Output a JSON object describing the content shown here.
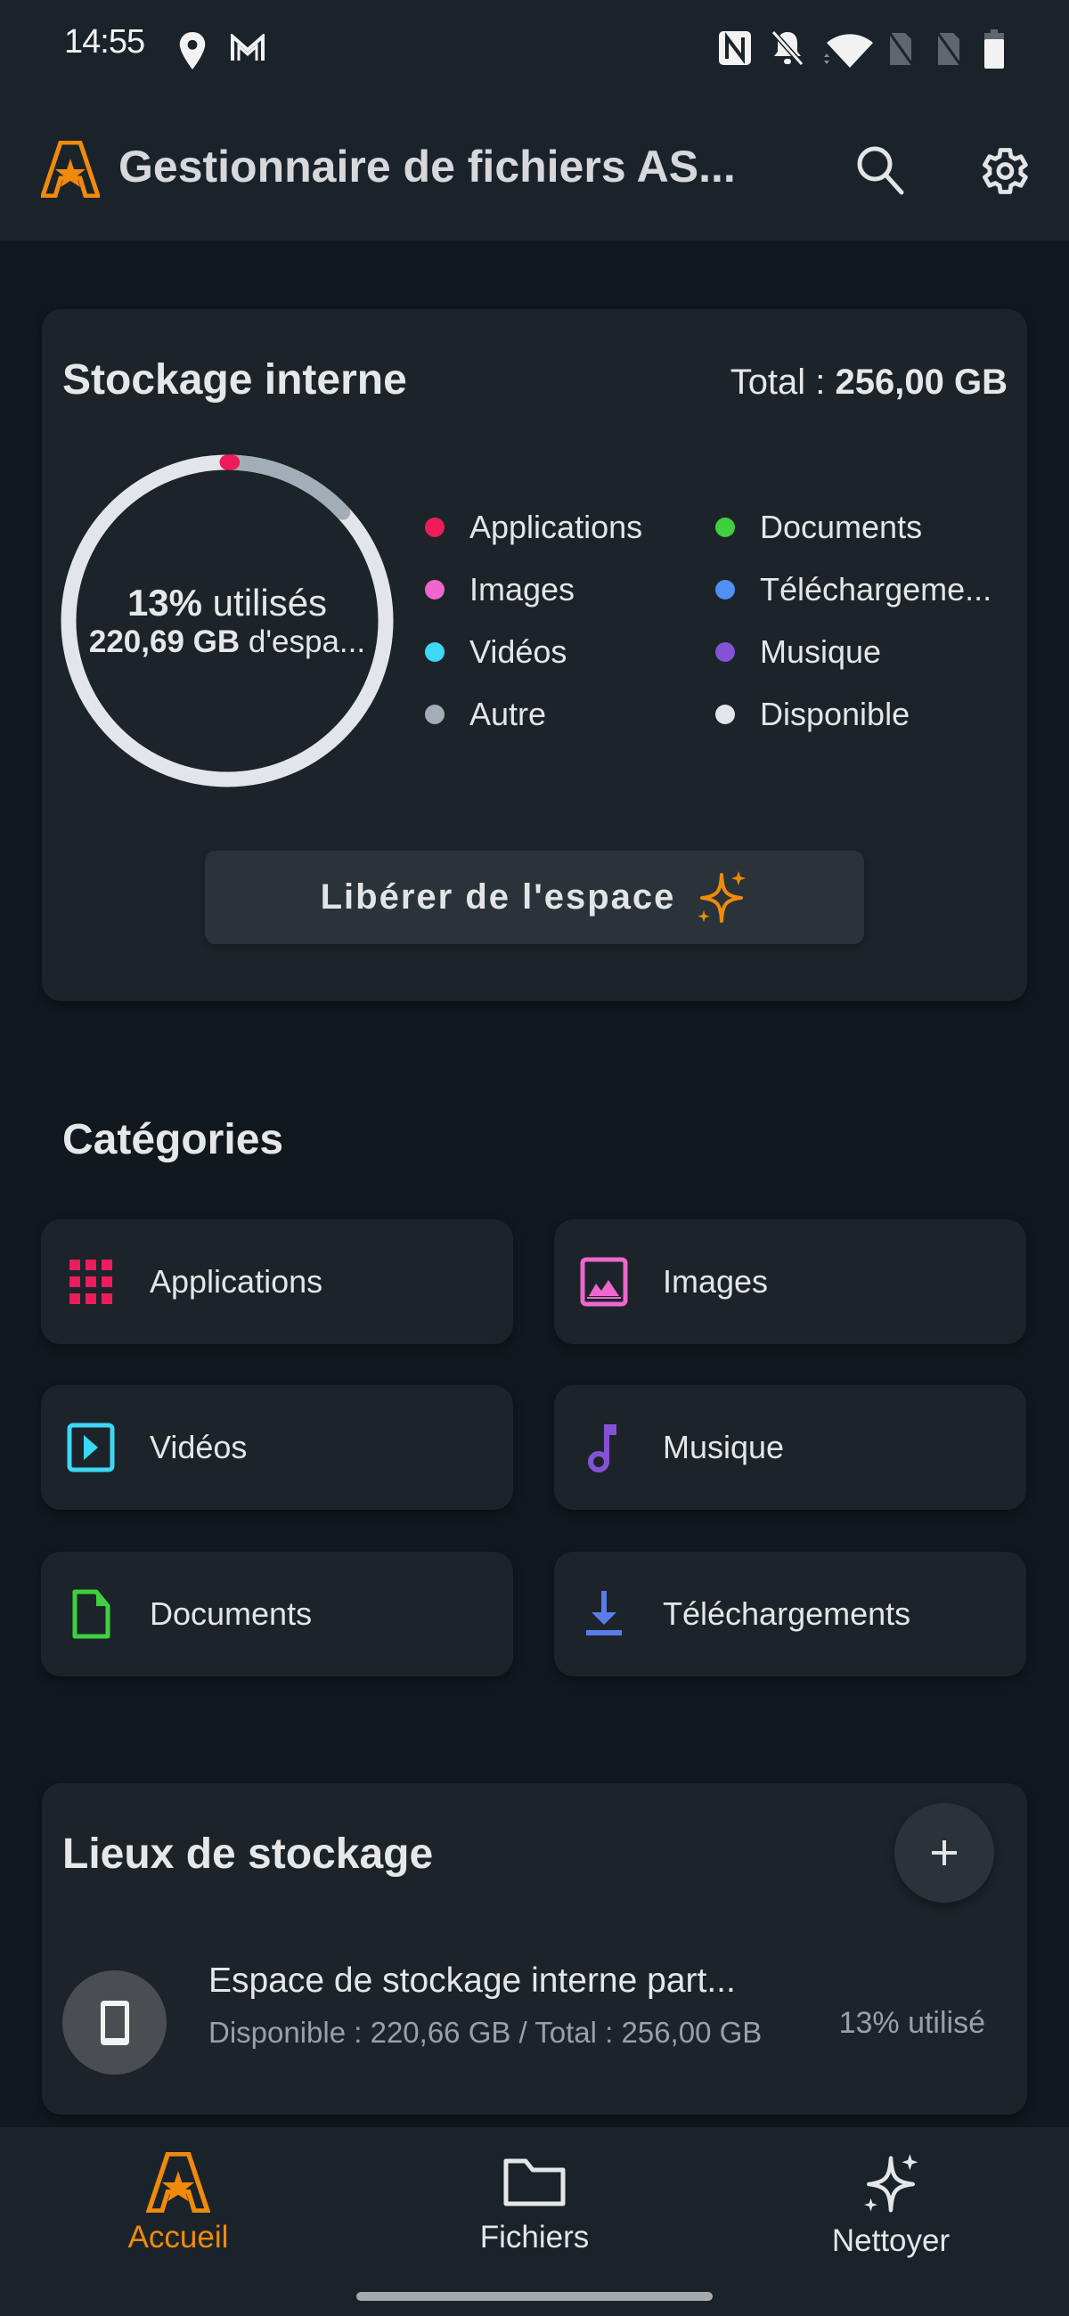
{
  "status_bar": {
    "time": "14:55",
    "left_icons": [
      "location-icon",
      "gmail-icon"
    ],
    "right_icons": [
      "nfc-icon",
      "bell-off-icon",
      "wifi-icon",
      "no-sim-icon",
      "no-sim-icon",
      "battery-icon"
    ]
  },
  "app_bar": {
    "title": "Gestionnaire de fichiers AS...",
    "logo_icon": "astro-logo-icon",
    "actions": [
      "search-icon",
      "settings-gear-icon"
    ]
  },
  "storage": {
    "title": "Stockage interne",
    "total_prefix": "Total : ",
    "total_value": "256,00 GB",
    "used_percent_value": "13%",
    "used_percent_suffix": " utilisés",
    "free_value": "220,69 GB",
    "free_suffix": " d'espa...",
    "free_button_label": "Libérer de l'espace",
    "free_button_icon": "sparkle-icon"
  },
  "chart_data": {
    "type": "pie",
    "variant": "donut",
    "title": "Stockage interne",
    "total": "256,00 GB",
    "center_text": [
      "13% utilisés",
      "220,69 GB d'espa..."
    ],
    "start_angle": "top",
    "direction": "clockwise",
    "slices": [
      {
        "label": "Applications",
        "percent": 0.5,
        "color": "#ee1c5a"
      },
      {
        "label": "Images",
        "percent": 0,
        "color": "#f066cf"
      },
      {
        "label": "Vidéos",
        "percent": 0,
        "color": "#3cd8f5"
      },
      {
        "label": "Documents",
        "percent": 0,
        "color": "#3fcf3f"
      },
      {
        "label": "Téléchargements",
        "percent": 0,
        "color": "#4f90f5"
      },
      {
        "label": "Musique",
        "percent": 0,
        "color": "#8552d6"
      },
      {
        "label": "Autre",
        "percent": 12.5,
        "color": "#a3adb8"
      },
      {
        "label": "Disponible",
        "percent": 87,
        "color": "#e2e5ea"
      }
    ]
  },
  "legend": [
    {
      "label": "Applications",
      "color": "#ee1c5a"
    },
    {
      "label": "Documents",
      "color": "#3fcf3f"
    },
    {
      "label": "Images",
      "color": "#f066cf"
    },
    {
      "label": "Téléchargeme...",
      "color": "#4f90f5"
    },
    {
      "label": "Vidéos",
      "color": "#3cd8f5"
    },
    {
      "label": "Musique",
      "color": "#8552d6"
    },
    {
      "label": "Autre",
      "color": "#a3adb8"
    },
    {
      "label": "Disponible",
      "color": "#e2e5ea"
    }
  ],
  "categories": {
    "title": "Catégories",
    "items": [
      {
        "label": "Applications",
        "icon": "apps-grid-icon",
        "color": "#ee1c5a"
      },
      {
        "label": "Images",
        "icon": "image-icon",
        "color": "#f066cf"
      },
      {
        "label": "Vidéos",
        "icon": "video-icon",
        "color": "#3cd8f5"
      },
      {
        "label": "Musique",
        "icon": "music-note-icon",
        "color": "#8552d6"
      },
      {
        "label": "Documents",
        "icon": "document-icon",
        "color": "#3fcf3f"
      },
      {
        "label": "Téléchargements",
        "icon": "download-icon",
        "color": "#5a7bea"
      }
    ]
  },
  "locations": {
    "title": "Lieux de stockage",
    "add_icon": "plus-icon",
    "items": [
      {
        "name": "Espace de stockage interne part...",
        "detail": "Disponible : 220,66 GB / Total : 256,00 GB",
        "usage": "13% utilisé",
        "icon": "phone-icon"
      }
    ]
  },
  "bottom_nav": {
    "items": [
      {
        "label": "Accueil",
        "icon": "astro-logo-icon",
        "active": true
      },
      {
        "label": "Fichiers",
        "icon": "folder-icon",
        "active": false
      },
      {
        "label": "Nettoyer",
        "icon": "sparkle-icon",
        "active": false
      }
    ],
    "active_color": "#f08a0a",
    "inactive_color": "#e4e6e8"
  },
  "colors": {
    "accent": "#f08a0a",
    "background": "#11181e",
    "surface": "#1c242a",
    "button": "#2a3339"
  }
}
